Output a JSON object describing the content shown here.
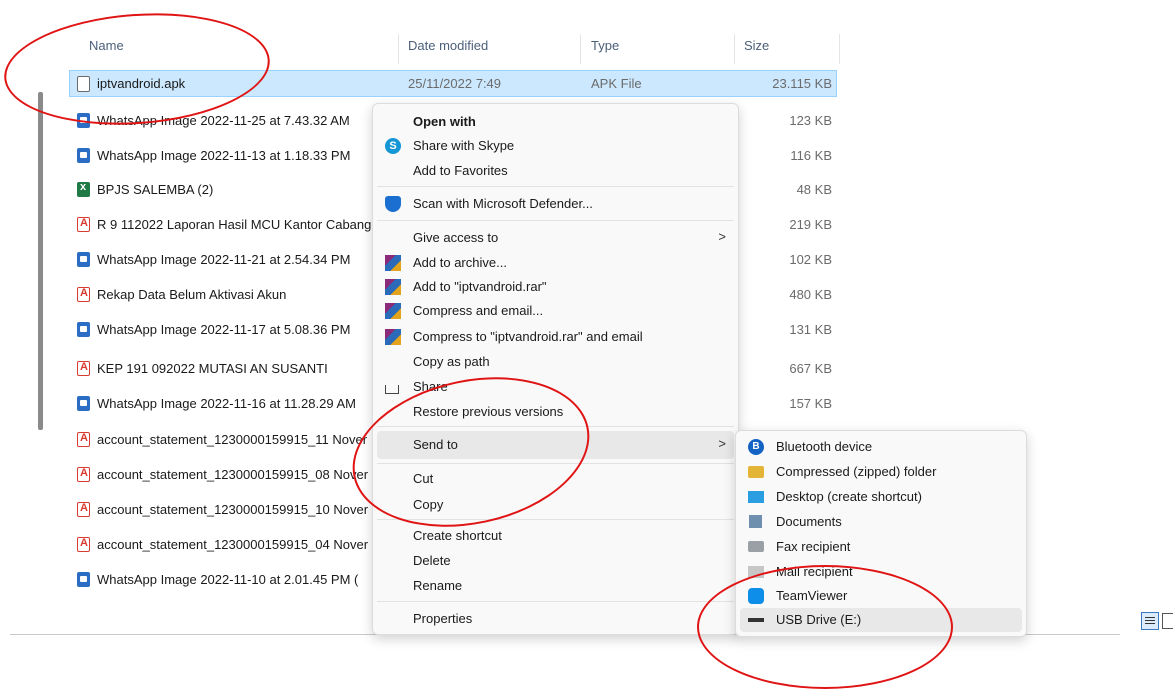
{
  "columns": {
    "name": "Name",
    "date": "Date modified",
    "type": "Type",
    "size": "Size"
  },
  "files": [
    {
      "name": "iptvandroid.apk",
      "date": "25/11/2022 7:49",
      "type": "APK File",
      "size": "23.115 KB",
      "icon": "apk-file-icon"
    },
    {
      "name": "WhatsApp Image 2022-11-25 at 7.43.32 AM",
      "size": "123 KB",
      "icon": "image-file-icon"
    },
    {
      "name": "WhatsApp Image 2022-11-13 at 1.18.33 PM",
      "size": "116 KB",
      "icon": "image-file-icon"
    },
    {
      "name": "BPJS SALEMBA (2)",
      "size": "48 KB",
      "icon": "excel-file-icon"
    },
    {
      "name": "R 9 112022 Laporan Hasil MCU Kantor Cabang",
      "size": "219 KB",
      "icon": "pdf-file-icon"
    },
    {
      "name": "WhatsApp Image 2022-11-21 at 2.54.34 PM",
      "size": "102 KB",
      "icon": "image-file-icon"
    },
    {
      "name": "Rekap Data Belum Aktivasi Akun",
      "size": "480 KB",
      "icon": "pdf-file-icon"
    },
    {
      "name": "WhatsApp Image 2022-11-17 at 5.08.36 PM",
      "size": "131 KB",
      "icon": "image-file-icon"
    },
    {
      "name": "KEP 191 092022 MUTASI AN SUSANTI",
      "size": "667 KB",
      "icon": "pdf-file-icon"
    },
    {
      "name": "WhatsApp Image 2022-11-16 at 11.28.29 AM",
      "size": "157 KB",
      "icon": "image-file-icon"
    },
    {
      "name": "account_statement_1230000159915_11 Nover",
      "icon": "pdf-file-icon"
    },
    {
      "name": "account_statement_1230000159915_08 Nover",
      "icon": "pdf-file-icon"
    },
    {
      "name": "account_statement_1230000159915_10 Nover",
      "icon": "pdf-file-icon"
    },
    {
      "name": "account_statement_1230000159915_04 Nover",
      "icon": "pdf-file-icon"
    },
    {
      "name": "WhatsApp Image 2022-11-10 at 2.01.45 PM (",
      "icon": "image-file-icon"
    }
  ],
  "context_menu": {
    "open_with": "Open with",
    "share_skype": "Share with Skype",
    "add_favorites": "Add to Favorites",
    "scan_defender": "Scan with Microsoft Defender...",
    "give_access": "Give access to",
    "add_archive": "Add to archive...",
    "add_rar": "Add to \"iptvandroid.rar\"",
    "compress_email": "Compress and email...",
    "compress_rar_email": "Compress to \"iptvandroid.rar\" and email",
    "copy_path": "Copy as path",
    "share": "Share",
    "restore": "Restore previous versions",
    "send_to": "Send to",
    "cut": "Cut",
    "copy": "Copy",
    "create_shortcut": "Create shortcut",
    "delete": "Delete",
    "rename": "Rename",
    "properties": "Properties",
    "arrow": ">"
  },
  "send_to_menu": [
    {
      "label": "Bluetooth device",
      "icon": "bluetooth-icon"
    },
    {
      "label": "Compressed (zipped) folder",
      "icon": "zip-folder-icon"
    },
    {
      "label": "Desktop (create shortcut)",
      "icon": "desktop-icon"
    },
    {
      "label": "Documents",
      "icon": "documents-icon"
    },
    {
      "label": "Fax recipient",
      "icon": "fax-icon"
    },
    {
      "label": "Mail recipient",
      "icon": "mail-icon"
    },
    {
      "label": "TeamViewer",
      "icon": "teamviewer-icon"
    },
    {
      "label": "USB Drive (E:)",
      "icon": "usb-drive-icon"
    }
  ],
  "colors": {
    "annotation": "#e01414",
    "selection": "#cce8ff"
  }
}
